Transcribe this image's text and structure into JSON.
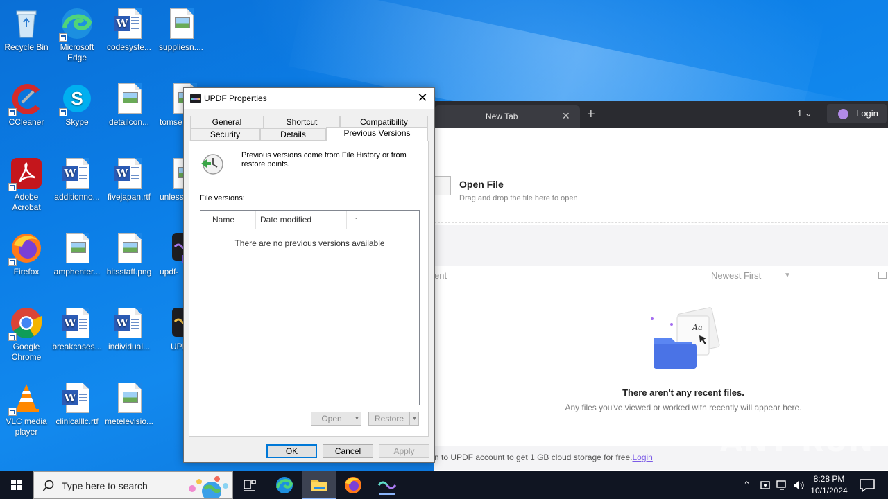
{
  "desktop": {
    "icons": [
      {
        "label": "Recycle Bin"
      },
      {
        "label": "Microsoft Edge"
      },
      {
        "label": "codesyste..."
      },
      {
        "label": "suppliesn...."
      },
      {
        "label": "CCleaner"
      },
      {
        "label": "Skype"
      },
      {
        "label": "detailcon..."
      },
      {
        "label": "tomse"
      },
      {
        "label": "Adobe Acrobat"
      },
      {
        "label": "additionno..."
      },
      {
        "label": "fivejapan.rtf"
      },
      {
        "label": "unless"
      },
      {
        "label": "Firefox"
      },
      {
        "label": "amphenter..."
      },
      {
        "label": "hitsstaff.png"
      },
      {
        "label": "updf-"
      },
      {
        "label": "Google Chrome"
      },
      {
        "label": "breakcases..."
      },
      {
        "label": "individual..."
      },
      {
        "label": "UPI"
      },
      {
        "label": "VLC media player"
      },
      {
        "label": "clinicalllc.rtf"
      },
      {
        "label": "metelevisio..."
      }
    ]
  },
  "app": {
    "tab_title": "New Tab",
    "tab_count": "1",
    "login_label": "Login",
    "open_file_title": "Open File",
    "open_file_hint": "Drag and drop the file here to open",
    "recent_label": "ent",
    "sort_label": "Newest First",
    "empty_title": "There aren't any recent files.",
    "empty_hint": "Any files you've viewed or worked with recently will appear here.",
    "banner_text": "n to UPDF account to get 1 GB cloud storage for free.",
    "banner_link": "Login"
  },
  "watermark": "ANY RUN",
  "dialog": {
    "title": "UPDF Properties",
    "tabs_row1": [
      "General",
      "Shortcut",
      "Compatibility"
    ],
    "tabs_row2": [
      "Security",
      "Details",
      "Previous Versions"
    ],
    "description": "Previous versions come from File History or from restore points.",
    "file_versions_label": "File versions:",
    "columns": [
      "Name",
      "Date modified"
    ],
    "empty_message": "There are no previous versions available",
    "open_label": "Open",
    "restore_label": "Restore",
    "ok_label": "OK",
    "cancel_label": "Cancel",
    "apply_label": "Apply"
  },
  "taskbar": {
    "search_placeholder": "Type here to search",
    "time": "8:28 PM",
    "date": "10/1/2024"
  },
  "colors": {
    "accent": "#0078d7",
    "taskbar": "#101522",
    "app_titlebar": "#2a2b30",
    "link": "#7b5be6"
  }
}
